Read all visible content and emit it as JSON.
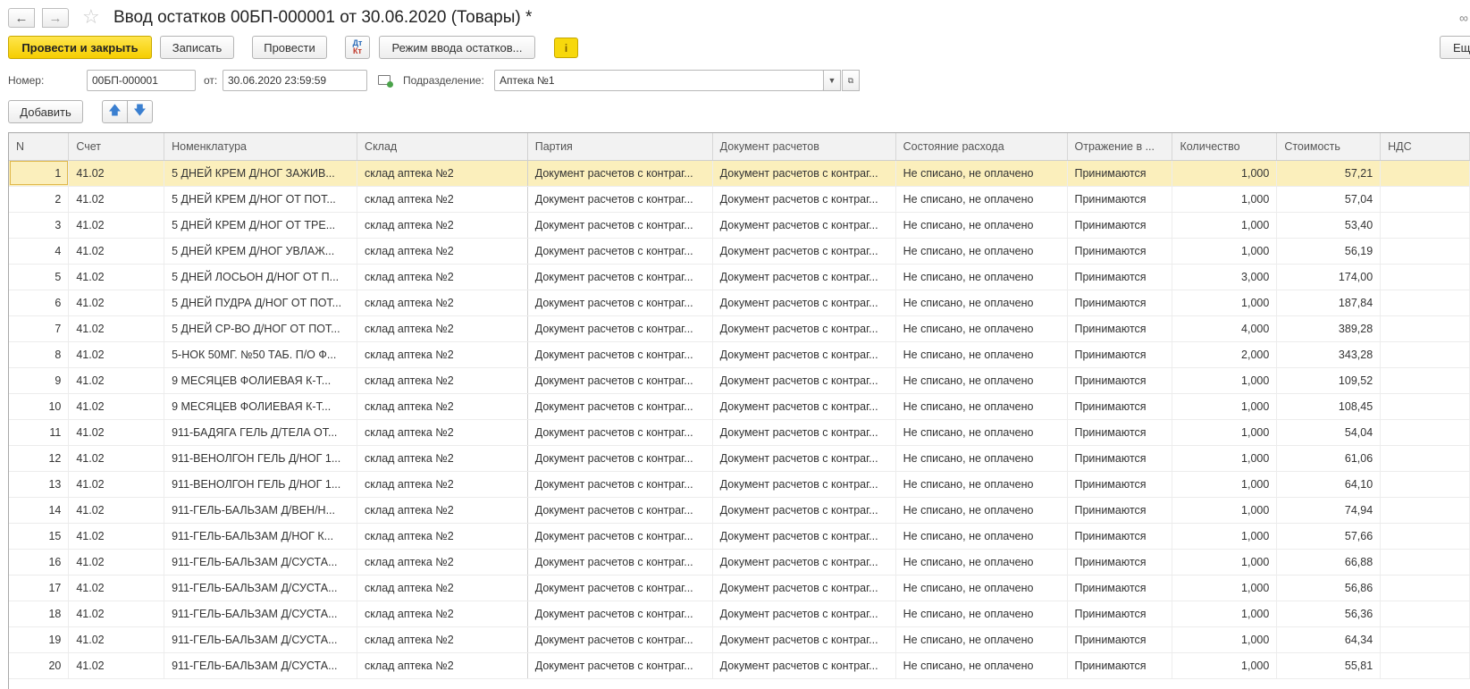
{
  "window": {
    "title": "Ввод остатков 00БП-000001 от 30.06.2020 (Товары) *",
    "back_icon": "arrow-left-icon",
    "forward_icon": "arrow-right-icon",
    "favorite_icon": "star-icon",
    "link_icon": "link-icon"
  },
  "toolbar": {
    "post_and_close": "Провести и закрыть",
    "save": "Записать",
    "post": "Провести",
    "dt_kt_top": "Дт",
    "dt_kt_bottom": "Кт",
    "balance_mode": "Режим ввода остатков...",
    "info_icon": "i",
    "more": "Ещ"
  },
  "form": {
    "number_label": "Номер:",
    "number_value": "00БП-000001",
    "date_label": "от:",
    "date_value": "30.06.2020 23:59:59",
    "division_label": "Подразделение:",
    "division_value": "Аптека №1"
  },
  "table_toolbar": {
    "add": "Добавить",
    "up_icon": "arrow-up-icon",
    "down_icon": "arrow-down-icon"
  },
  "table": {
    "columns": [
      "N",
      "Счет",
      "Номенклатура",
      "Склад",
      "Партия",
      "Документ расчетов",
      "Состояние расхода",
      "Отражение в ...",
      "Количество",
      "Стоимость",
      "НДС"
    ],
    "rows": [
      [
        "1",
        "41.02",
        "5 ДНЕЙ КРЕМ Д/НОГ ЗАЖИВ...",
        "склад аптека №2",
        "Документ расчетов с контраг...",
        "Документ расчетов с контраг...",
        "Не списано, не оплачено",
        "Принимаются",
        "1,000",
        "57,21",
        ""
      ],
      [
        "2",
        "41.02",
        "5 ДНЕЙ КРЕМ Д/НОГ ОТ ПОТ...",
        "склад аптека №2",
        "Документ расчетов с контраг...",
        "Документ расчетов с контраг...",
        "Не списано, не оплачено",
        "Принимаются",
        "1,000",
        "57,04",
        ""
      ],
      [
        "3",
        "41.02",
        "5 ДНЕЙ КРЕМ Д/НОГ ОТ ТРЕ...",
        "склад аптека №2",
        "Документ расчетов с контраг...",
        "Документ расчетов с контраг...",
        "Не списано, не оплачено",
        "Принимаются",
        "1,000",
        "53,40",
        ""
      ],
      [
        "4",
        "41.02",
        "5 ДНЕЙ КРЕМ Д/НОГ УВЛАЖ...",
        "склад аптека №2",
        "Документ расчетов с контраг...",
        "Документ расчетов с контраг...",
        "Не списано, не оплачено",
        "Принимаются",
        "1,000",
        "56,19",
        ""
      ],
      [
        "5",
        "41.02",
        "5 ДНЕЙ ЛОСЬОН Д/НОГ ОТ П...",
        "склад аптека №2",
        "Документ расчетов с контраг...",
        "Документ расчетов с контраг...",
        "Не списано, не оплачено",
        "Принимаются",
        "3,000",
        "174,00",
        ""
      ],
      [
        "6",
        "41.02",
        "5 ДНЕЙ ПУДРА Д/НОГ ОТ ПОТ...",
        "склад аптека №2",
        "Документ расчетов с контраг...",
        "Документ расчетов с контраг...",
        "Не списано, не оплачено",
        "Принимаются",
        "1,000",
        "187,84",
        ""
      ],
      [
        "7",
        "41.02",
        "5 ДНЕЙ СР-ВО Д/НОГ ОТ ПОТ...",
        "склад аптека №2",
        "Документ расчетов с контраг...",
        "Документ расчетов с контраг...",
        "Не списано, не оплачено",
        "Принимаются",
        "4,000",
        "389,28",
        ""
      ],
      [
        "8",
        "41.02",
        "5-НОК 50МГ. №50 ТАБ. П/О Ф...",
        "склад аптека №2",
        "Документ расчетов с контраг...",
        "Документ расчетов с контраг...",
        "Не списано, не оплачено",
        "Принимаются",
        "2,000",
        "343,28",
        ""
      ],
      [
        "9",
        "41.02",
        "9 МЕСЯЦЕВ ФОЛИЕВАЯ К-Т...",
        "склад аптека №2",
        "Документ расчетов с контраг...",
        "Документ расчетов с контраг...",
        "Не списано, не оплачено",
        "Принимаются",
        "1,000",
        "109,52",
        ""
      ],
      [
        "10",
        "41.02",
        "9 МЕСЯЦЕВ ФОЛИЕВАЯ К-Т...",
        "склад аптека №2",
        "Документ расчетов с контраг...",
        "Документ расчетов с контраг...",
        "Не списано, не оплачено",
        "Принимаются",
        "1,000",
        "108,45",
        ""
      ],
      [
        "11",
        "41.02",
        "911-БАДЯГА ГЕЛЬ Д/ТЕЛА ОТ...",
        "склад аптека №2",
        "Документ расчетов с контраг...",
        "Документ расчетов с контраг...",
        "Не списано, не оплачено",
        "Принимаются",
        "1,000",
        "54,04",
        ""
      ],
      [
        "12",
        "41.02",
        "911-ВЕНОЛГОН ГЕЛЬ Д/НОГ 1...",
        "склад аптека №2",
        "Документ расчетов с контраг...",
        "Документ расчетов с контраг...",
        "Не списано, не оплачено",
        "Принимаются",
        "1,000",
        "61,06",
        ""
      ],
      [
        "13",
        "41.02",
        "911-ВЕНОЛГОН ГЕЛЬ Д/НОГ 1...",
        "склад аптека №2",
        "Документ расчетов с контраг...",
        "Документ расчетов с контраг...",
        "Не списано, не оплачено",
        "Принимаются",
        "1,000",
        "64,10",
        ""
      ],
      [
        "14",
        "41.02",
        "911-ГЕЛЬ-БАЛЬЗАМ Д/ВЕН/Н...",
        "склад аптека №2",
        "Документ расчетов с контраг...",
        "Документ расчетов с контраг...",
        "Не списано, не оплачено",
        "Принимаются",
        "1,000",
        "74,94",
        ""
      ],
      [
        "15",
        "41.02",
        "911-ГЕЛЬ-БАЛЬЗАМ Д/НОГ К...",
        "склад аптека №2",
        "Документ расчетов с контраг...",
        "Документ расчетов с контраг...",
        "Не списано, не оплачено",
        "Принимаются",
        "1,000",
        "57,66",
        ""
      ],
      [
        "16",
        "41.02",
        "911-ГЕЛЬ-БАЛЬЗАМ Д/СУСТА...",
        "склад аптека №2",
        "Документ расчетов с контраг...",
        "Документ расчетов с контраг...",
        "Не списано, не оплачено",
        "Принимаются",
        "1,000",
        "66,88",
        ""
      ],
      [
        "17",
        "41.02",
        "911-ГЕЛЬ-БАЛЬЗАМ Д/СУСТА...",
        "склад аптека №2",
        "Документ расчетов с контраг...",
        "Документ расчетов с контраг...",
        "Не списано, не оплачено",
        "Принимаются",
        "1,000",
        "56,86",
        ""
      ],
      [
        "18",
        "41.02",
        "911-ГЕЛЬ-БАЛЬЗАМ Д/СУСТА...",
        "склад аптека №2",
        "Документ расчетов с контраг...",
        "Документ расчетов с контраг...",
        "Не списано, не оплачено",
        "Принимаются",
        "1,000",
        "56,36",
        ""
      ],
      [
        "19",
        "41.02",
        "911-ГЕЛЬ-БАЛЬЗАМ Д/СУСТА...",
        "склад аптека №2",
        "Документ расчетов с контраг...",
        "Документ расчетов с контраг...",
        "Не списано, не оплачено",
        "Принимаются",
        "1,000",
        "64,34",
        ""
      ],
      [
        "20",
        "41.02",
        "911-ГЕЛЬ-БАЛЬЗАМ Д/СУСТА...",
        "склад аптека №2",
        "Документ расчетов с контраг...",
        "Документ расчетов с контраг...",
        "Не списано, не оплачено",
        "Принимаются",
        "1,000",
        "55,81",
        ""
      ]
    ],
    "selected_row": 0
  },
  "colors": {
    "primary_button": "#f5cd00",
    "selected_row": "#fbefbc",
    "arrow_blue": "#3a7fd0"
  }
}
